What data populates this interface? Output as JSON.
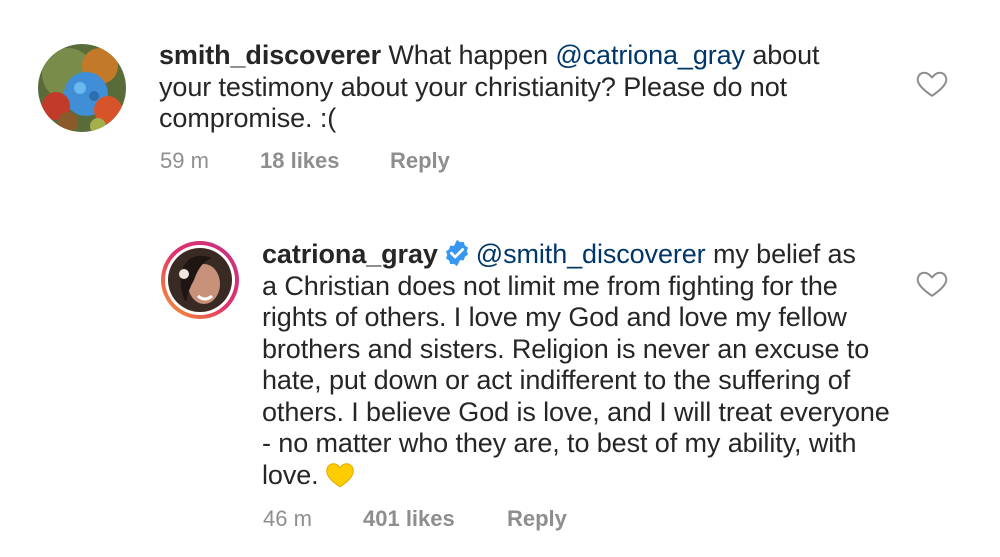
{
  "comment1": {
    "username": "smith_discoverer",
    "text_before_mention": "What happen ",
    "mention": "@catriona_gray",
    "text_after_mention_line1": " about",
    "line2": "your testimony about your christianity? Please do not",
    "line3": "compromise. :(",
    "time": "59 m",
    "likes": "18 likes",
    "reply": "Reply",
    "avatar_icon": "frog-avatar"
  },
  "comment2": {
    "username": "catriona_gray",
    "verified_icon": "verified-badge-icon",
    "mention": "@smith_discoverer",
    "text_line1": " my belief as",
    "line2": "a Christian does not limit me from fighting for the",
    "line3": "rights of others. I love my God and love my fellow",
    "line4": "brothers and sisters. Religion is never an excuse to",
    "line5": "hate, put down or act indifferent to the suffering of",
    "line6": "others. I believe God is love, and I will treat everyone",
    "line7": "- no matter who they are, to best of my ability, with",
    "line8": "love.",
    "emoji_icon": "yellow-heart-icon",
    "time": "46 m",
    "likes": "401 likes",
    "reply": "Reply",
    "avatar_icon": "profile-photo-story-ring"
  },
  "colors": {
    "text": "#262626",
    "mention": "#00376b",
    "meta": "#8e8e8e",
    "verified": "#3897f0",
    "emoji": "#ffcc00"
  }
}
